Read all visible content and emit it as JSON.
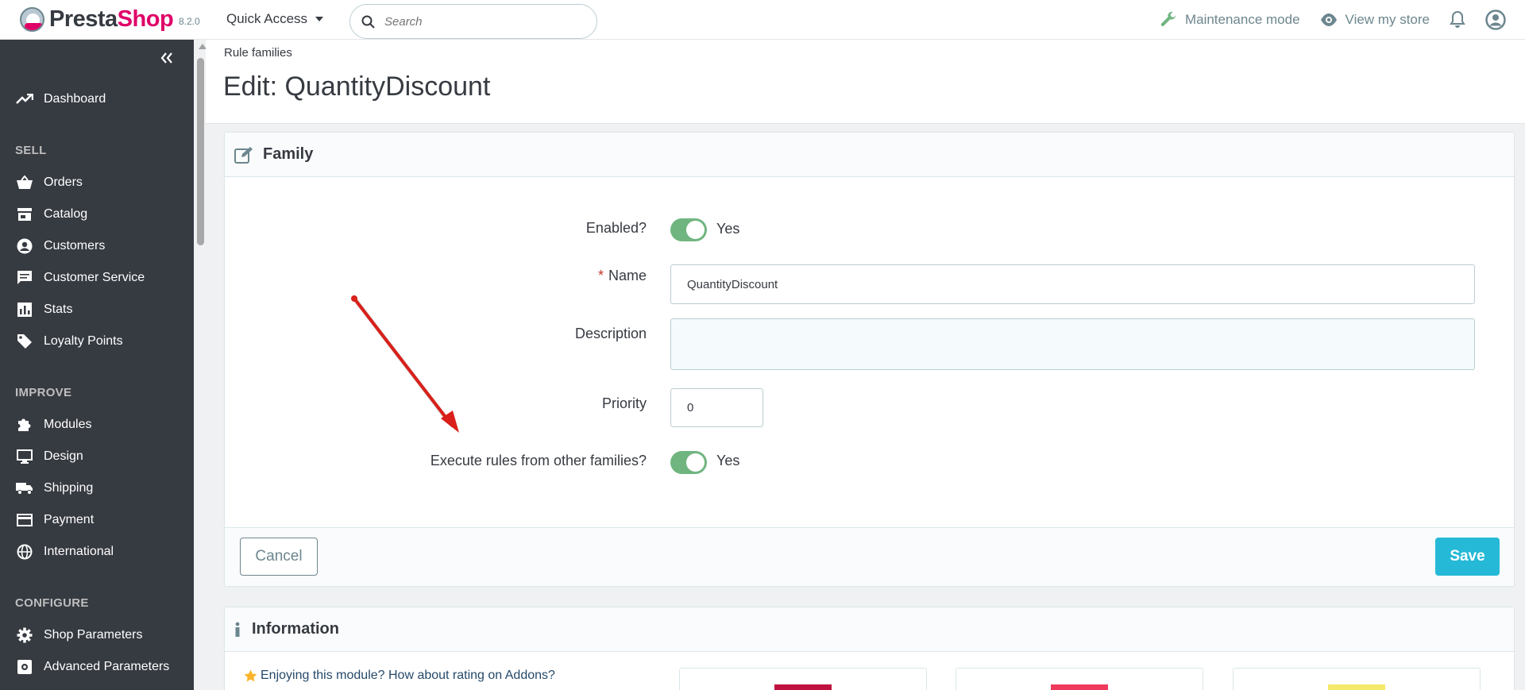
{
  "header": {
    "logo_part1": "Presta",
    "logo_part2": "Shop",
    "version": "8.2.0",
    "quick_access": "Quick Access",
    "search_placeholder": "Search",
    "maintenance": "Maintenance mode",
    "view_store": "View my store"
  },
  "sidebar": {
    "dashboard": "Dashboard",
    "sections": {
      "sell": "SELL",
      "improve": "IMPROVE",
      "configure": "CONFIGURE"
    },
    "sell_items": [
      "Orders",
      "Catalog",
      "Customers",
      "Customer Service",
      "Stats",
      "Loyalty Points"
    ],
    "improve_items": [
      "Modules",
      "Design",
      "Shipping",
      "Payment",
      "International"
    ],
    "configure_items": [
      "Shop Parameters",
      "Advanced Parameters"
    ]
  },
  "page": {
    "breadcrumb": "Rule families",
    "title": "Edit: QuantityDiscount"
  },
  "form": {
    "panel_title": "Family",
    "enabled_label": "Enabled?",
    "enabled_value": "Yes",
    "name_label": "Name",
    "name_required_mark": "*",
    "name_value": "QuantityDiscount",
    "description_label": "Description",
    "description_value": "",
    "priority_label": "Priority",
    "priority_value": "0",
    "execute_label": "Execute rules from other families?",
    "execute_value": "Yes",
    "cancel": "Cancel",
    "save": "Save"
  },
  "info": {
    "panel_title": "Information",
    "rating_text": "Enjoying this module? How about rating on Addons?"
  },
  "colors": {
    "sidebar_bg": "#363a41",
    "accent": "#25b9d7",
    "toggle_on": "#70b580",
    "brand": "#df0067",
    "annotation_arrow": "#d9201a"
  }
}
